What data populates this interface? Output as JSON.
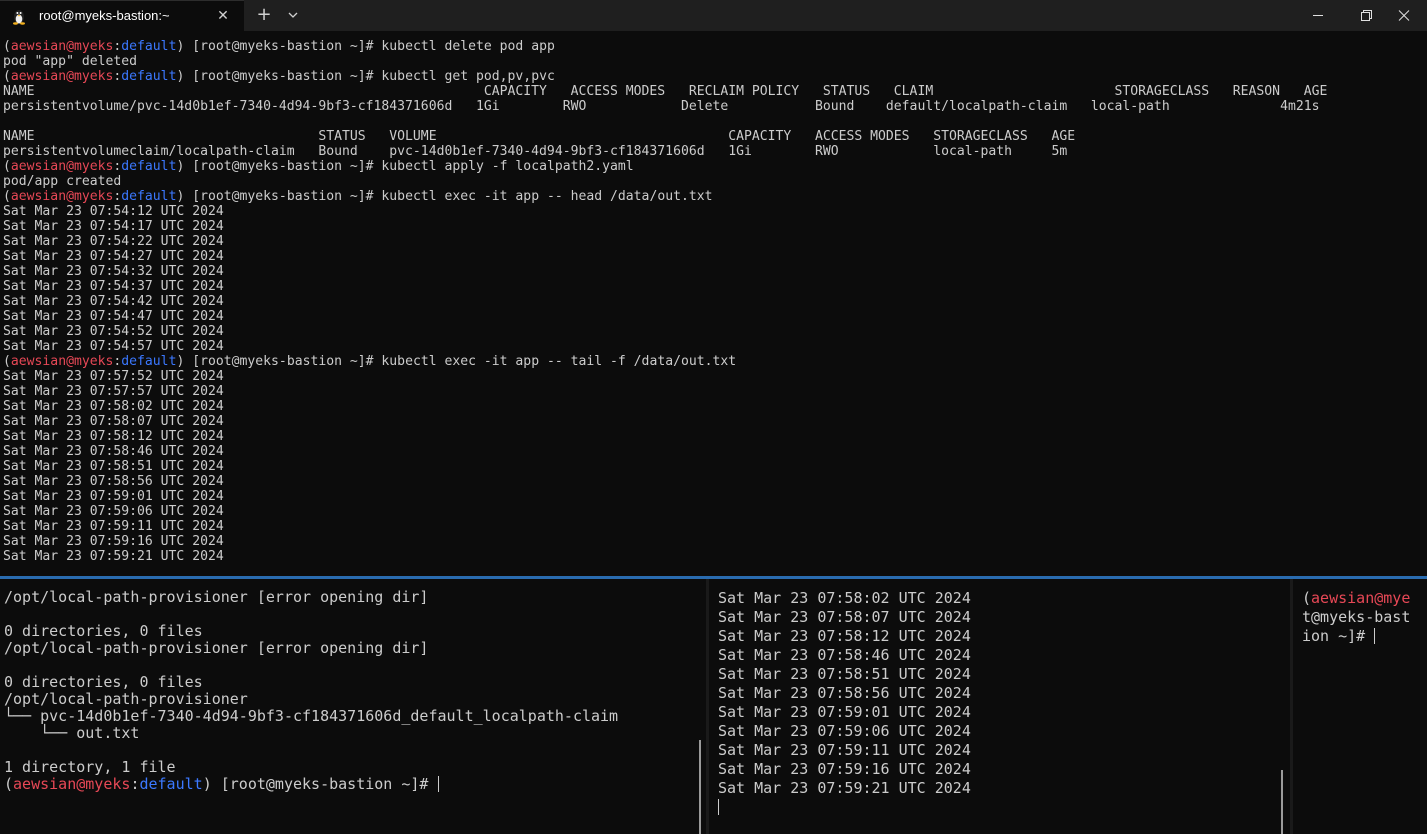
{
  "window": {
    "tab_title": "root@myeks-bastion:~",
    "tab_icon": "linux-penguin-icon",
    "close_tab_icon": "✕",
    "new_tab_icon": "+",
    "colors": {
      "red": "#e74856",
      "blue": "#3b78ff",
      "text": "#cccccc",
      "divider": "#2a6cb0"
    }
  },
  "top_pane": {
    "lines": [
      [
        [
          "(",
          ""
        ],
        [
          "aewsian@myeks",
          "red"
        ],
        [
          ":",
          ""
        ],
        [
          "default",
          "blue"
        ],
        [
          ") [root@myeks-bastion ~]# kubectl delete pod app",
          ""
        ]
      ],
      [
        [
          "pod \"app\" deleted",
          ""
        ]
      ],
      [
        [
          "(",
          ""
        ],
        [
          "aewsian@myeks",
          "red"
        ],
        [
          ":",
          ""
        ],
        [
          "default",
          "blue"
        ],
        [
          ") [root@myeks-bastion ~]# kubectl get pod,pv,pvc",
          ""
        ]
      ],
      [
        [
          "NAME                                                         CAPACITY   ACCESS MODES   RECLAIM POLICY   STATUS   CLAIM                       STORAGECLASS   REASON   AGE",
          ""
        ]
      ],
      [
        [
          "persistentvolume/pvc-14d0b1ef-7340-4d94-9bf3-cf184371606d   1Gi        RWO            Delete           Bound    default/localpath-claim   local-path              4m21s",
          ""
        ]
      ],
      [
        [
          "",
          ""
        ]
      ],
      [
        [
          "NAME                                    STATUS   VOLUME                                     CAPACITY   ACCESS MODES   STORAGECLASS   AGE",
          ""
        ]
      ],
      [
        [
          "persistentvolumeclaim/localpath-claim   Bound    pvc-14d0b1ef-7340-4d94-9bf3-cf184371606d   1Gi        RWO            local-path     5m",
          ""
        ]
      ],
      [
        [
          "(",
          ""
        ],
        [
          "aewsian@myeks",
          "red"
        ],
        [
          ":",
          ""
        ],
        [
          "default",
          "blue"
        ],
        [
          ") [root@myeks-bastion ~]# kubectl apply -f localpath2.yaml",
          ""
        ]
      ],
      [
        [
          "pod/app created",
          ""
        ]
      ],
      [
        [
          "(",
          ""
        ],
        [
          "aewsian@myeks",
          "red"
        ],
        [
          ":",
          ""
        ],
        [
          "default",
          "blue"
        ],
        [
          ") [root@myeks-bastion ~]# kubectl exec -it app -- head /data/out.txt",
          ""
        ]
      ],
      [
        [
          "Sat Mar 23 07:54:12 UTC 2024",
          ""
        ]
      ],
      [
        [
          "Sat Mar 23 07:54:17 UTC 2024",
          ""
        ]
      ],
      [
        [
          "Sat Mar 23 07:54:22 UTC 2024",
          ""
        ]
      ],
      [
        [
          "Sat Mar 23 07:54:27 UTC 2024",
          ""
        ]
      ],
      [
        [
          "Sat Mar 23 07:54:32 UTC 2024",
          ""
        ]
      ],
      [
        [
          "Sat Mar 23 07:54:37 UTC 2024",
          ""
        ]
      ],
      [
        [
          "Sat Mar 23 07:54:42 UTC 2024",
          ""
        ]
      ],
      [
        [
          "Sat Mar 23 07:54:47 UTC 2024",
          ""
        ]
      ],
      [
        [
          "Sat Mar 23 07:54:52 UTC 2024",
          ""
        ]
      ],
      [
        [
          "Sat Mar 23 07:54:57 UTC 2024",
          ""
        ]
      ],
      [
        [
          "(",
          ""
        ],
        [
          "aewsian@myeks",
          "red"
        ],
        [
          ":",
          ""
        ],
        [
          "default",
          "blue"
        ],
        [
          ") [root@myeks-bastion ~]# kubectl exec -it app -- tail -f /data/out.txt",
          ""
        ]
      ],
      [
        [
          "Sat Mar 23 07:57:52 UTC 2024",
          ""
        ]
      ],
      [
        [
          "Sat Mar 23 07:57:57 UTC 2024",
          ""
        ]
      ],
      [
        [
          "Sat Mar 23 07:58:02 UTC 2024",
          ""
        ]
      ],
      [
        [
          "Sat Mar 23 07:58:07 UTC 2024",
          ""
        ]
      ],
      [
        [
          "Sat Mar 23 07:58:12 UTC 2024",
          ""
        ]
      ],
      [
        [
          "Sat Mar 23 07:58:46 UTC 2024",
          ""
        ]
      ],
      [
        [
          "Sat Mar 23 07:58:51 UTC 2024",
          ""
        ]
      ],
      [
        [
          "Sat Mar 23 07:58:56 UTC 2024",
          ""
        ]
      ],
      [
        [
          "Sat Mar 23 07:59:01 UTC 2024",
          ""
        ]
      ],
      [
        [
          "Sat Mar 23 07:59:06 UTC 2024",
          ""
        ]
      ],
      [
        [
          "Sat Mar 23 07:59:11 UTC 2024",
          ""
        ]
      ],
      [
        [
          "Sat Mar 23 07:59:16 UTC 2024",
          ""
        ]
      ],
      [
        [
          "Sat Mar 23 07:59:21 UTC 2024",
          ""
        ]
      ]
    ]
  },
  "bottom_left_pane": {
    "lines": [
      [
        [
          "/opt/local-path-provisioner [error opening dir]",
          ""
        ]
      ],
      [
        [
          "",
          ""
        ]
      ],
      [
        [
          "0 directories, 0 files",
          ""
        ]
      ],
      [
        [
          "/opt/local-path-provisioner [error opening dir]",
          ""
        ]
      ],
      [
        [
          "",
          ""
        ]
      ],
      [
        [
          "0 directories, 0 files",
          ""
        ]
      ],
      [
        [
          "/opt/local-path-provisioner",
          ""
        ]
      ],
      [
        [
          "└── pvc-14d0b1ef-7340-4d94-9bf3-cf184371606d_default_localpath-claim",
          ""
        ]
      ],
      [
        [
          "    └── out.txt",
          ""
        ]
      ],
      [
        [
          "",
          ""
        ]
      ],
      [
        [
          "1 directory, 1 file",
          ""
        ]
      ],
      [
        [
          "(",
          ""
        ],
        [
          "aewsian@myeks",
          "red"
        ],
        [
          ":",
          ""
        ],
        [
          "default",
          "blue"
        ],
        [
          ") [root@myeks-bastion ~]# ",
          ""
        ],
        [
          "|cursor",
          "cursor"
        ]
      ]
    ]
  },
  "bottom_mid_pane": {
    "lines": [
      [
        [
          "Sat Mar 23 07:58:02 UTC 2024",
          ""
        ]
      ],
      [
        [
          "Sat Mar 23 07:58:07 UTC 2024",
          ""
        ]
      ],
      [
        [
          "Sat Mar 23 07:58:12 UTC 2024",
          ""
        ]
      ],
      [
        [
          "Sat Mar 23 07:58:46 UTC 2024",
          ""
        ]
      ],
      [
        [
          "Sat Mar 23 07:58:51 UTC 2024",
          ""
        ]
      ],
      [
        [
          "Sat Mar 23 07:58:56 UTC 2024",
          ""
        ]
      ],
      [
        [
          "Sat Mar 23 07:59:01 UTC 2024",
          ""
        ]
      ],
      [
        [
          "Sat Mar 23 07:59:06 UTC 2024",
          ""
        ]
      ],
      [
        [
          "Sat Mar 23 07:59:11 UTC 2024",
          ""
        ]
      ],
      [
        [
          "Sat Mar 23 07:59:16 UTC 2024",
          ""
        ]
      ],
      [
        [
          "Sat Mar 23 07:59:21 UTC 2024",
          ""
        ]
      ],
      [
        [
          "|cursor",
          "cursor"
        ]
      ]
    ]
  },
  "bottom_right_pane": {
    "lines": [
      [
        [
          "(",
          ""
        ],
        [
          "aewsian@mye",
          "red"
        ]
      ],
      [
        [
          "t@myeks-bast",
          ""
        ]
      ],
      [
        [
          "ion ~]# ",
          ""
        ],
        [
          "|cursor",
          "cursor"
        ]
      ]
    ]
  }
}
